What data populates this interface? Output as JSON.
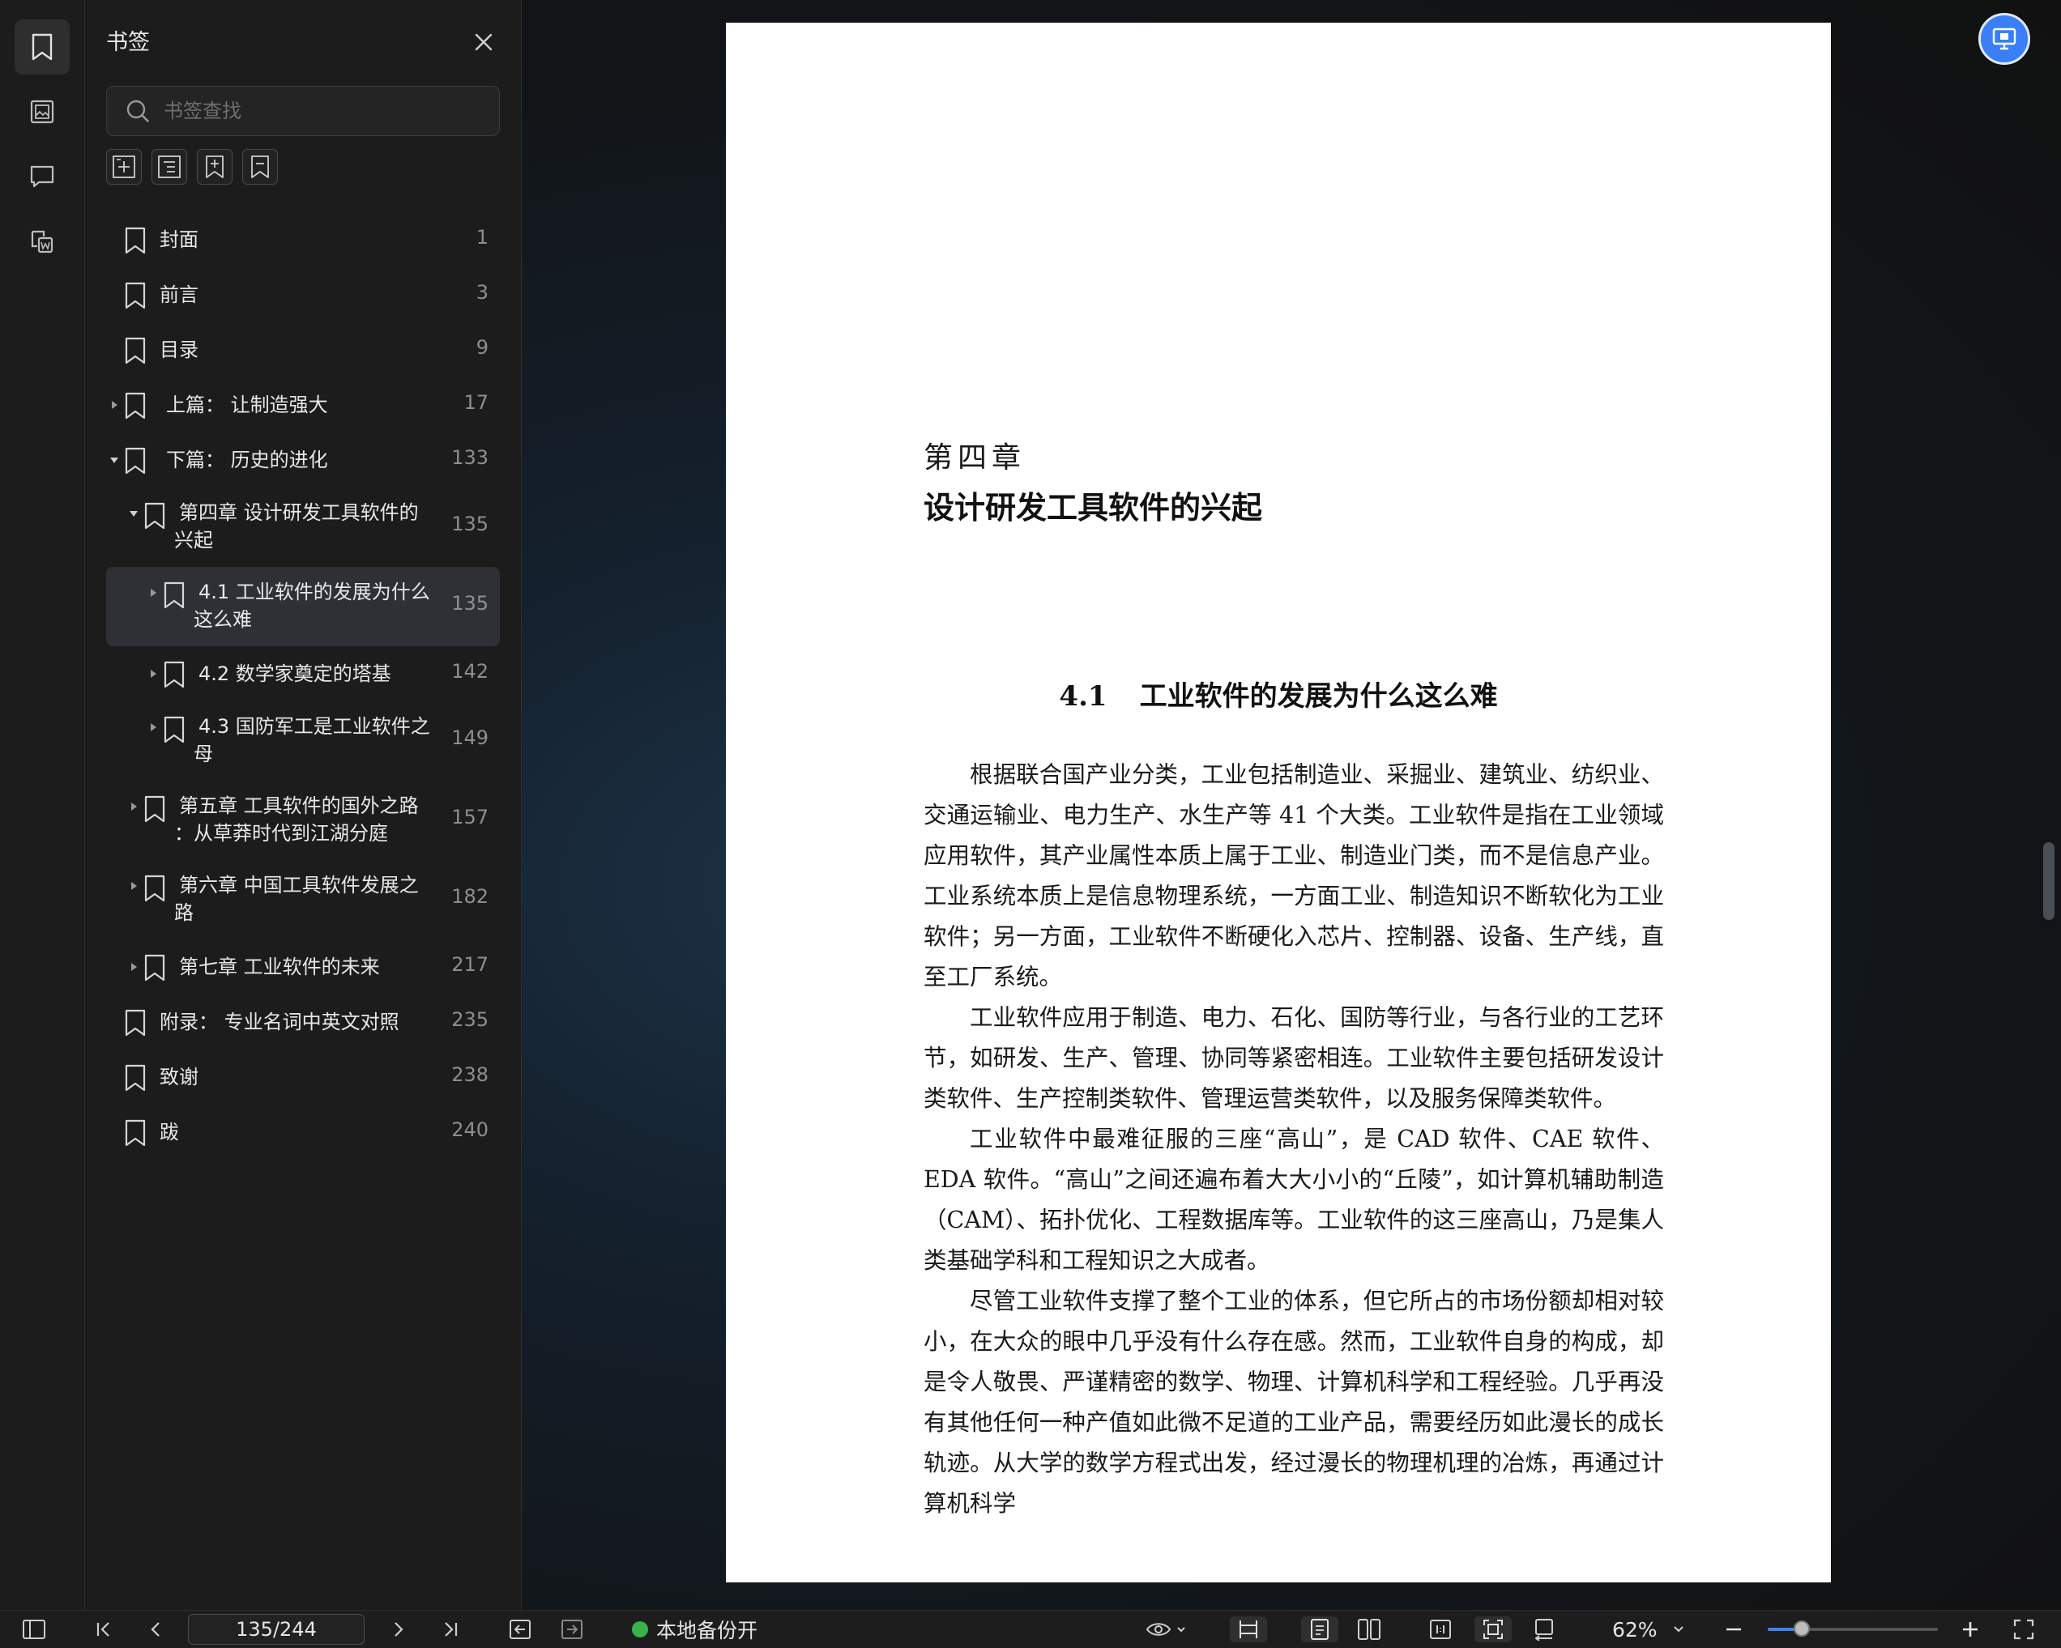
{
  "sidebar": {
    "title": "书签",
    "search_placeholder": "书签查找",
    "bookmarks": [
      {
        "label": "封面",
        "page": "1",
        "level": 0,
        "arrow": "none"
      },
      {
        "label": "前言",
        "page": "3",
        "level": 0,
        "arrow": "none"
      },
      {
        "label": "目录",
        "page": "9",
        "level": 0,
        "arrow": "none"
      },
      {
        "label": "上篇： 让制造强大",
        "page": "17",
        "level": 0,
        "arrow": "right"
      },
      {
        "label": "下篇： 历史的进化",
        "page": "133",
        "level": 0,
        "arrow": "down"
      },
      {
        "label": "第四章 设计研发工具软件的兴起",
        "page": "135",
        "level": 1,
        "arrow": "down",
        "lines": [
          "第四章 设计研发工具软件的",
          "兴起"
        ]
      },
      {
        "label": "4.1 工业软件的发展为什么这么难",
        "page": "135",
        "level": 2,
        "arrow": "right",
        "selected": true,
        "lines": [
          "4.1 工业软件的发展为什么",
          "这么难"
        ]
      },
      {
        "label": "4.2 数学家奠定的塔基",
        "page": "142",
        "level": 2,
        "arrow": "right"
      },
      {
        "label": "4.3 国防军工是工业软件之母",
        "page": "149",
        "level": 2,
        "arrow": "right",
        "lines": [
          "4.3 国防军工是工业软件之",
          "母"
        ]
      },
      {
        "label": "第五章 工具软件的国外之路：从草莽时代到江湖分庭",
        "page": "157",
        "level": 1,
        "arrow": "right",
        "lines": [
          "第五章 工具软件的国外之路",
          "：从草莽时代到江湖分庭"
        ]
      },
      {
        "label": "第六章 中国工具软件发展之路",
        "page": "182",
        "level": 1,
        "arrow": "right",
        "lines": [
          "第六章 中国工具软件发展之",
          "路"
        ]
      },
      {
        "label": "第七章 工业软件的未来",
        "page": "217",
        "level": 1,
        "arrow": "right"
      },
      {
        "label": "附录： 专业名词中英文对照",
        "page": "235",
        "level": 0,
        "arrow": "none"
      },
      {
        "label": "致谢",
        "page": "238",
        "level": 0,
        "arrow": "none"
      },
      {
        "label": "跋",
        "page": "240",
        "level": 0,
        "arrow": "none"
      }
    ]
  },
  "document": {
    "chapter_number": "第四章",
    "chapter_title": "设计研发工具软件的兴起",
    "section_number": "4.1",
    "section_title": "工业软件的发展为什么这么难",
    "paragraphs": [
      "根据联合国产业分类，工业包括制造业、采掘业、建筑业、纺织业、交通运输业、电力生产、水生产等 41 个大类。工业软件是指在工业领域应用软件，其产业属性本质上属于工业、制造业门类，而不是信息产业。工业系统本质上是信息物理系统，一方面工业、制造知识不断软化为工业软件；另一方面，工业软件不断硬化入芯片、控制器、设备、生产线，直至工厂系统。",
      "工业软件应用于制造、电力、石化、国防等行业，与各行业的工艺环节，如研发、生产、管理、协同等紧密相连。工业软件主要包括研发设计类软件、生产控制类软件、管理运营类软件，以及服务保障类软件。",
      "工业软件中最难征服的三座“高山”，是 CAD 软件、CAE 软件、EDA 软件。“高山”之间还遍布着大大小小的“丘陵”，如计算机辅助制造（CAM）、拓扑优化、工程数据库等。工业软件的这三座高山，乃是集人类基础学科和工程知识之大成者。",
      "尽管工业软件支撑了整个工业的体系，但它所占的市场份额却相对较小，在大众的眼中几乎没有什么存在感。然而，工业软件自身的构成，却是令人敬畏、严谨精密的数学、物理、计算机科学和工程经验。几乎再没有其他任何一种产值如此微不足道的工业产品，需要经历如此漫长的成长轨迹。从大学的数学方程式出发，经过漫长的物理机理的冶炼，再通过计算机科学"
    ]
  },
  "statusbar": {
    "page_indicator": "135/244",
    "backup_label": "本地备份开",
    "backup_color": "#38b24a",
    "zoom": "62%",
    "zoom_fraction": 0.2
  },
  "colors": {
    "accent": "#3b82f6",
    "panel": "#1c1c1c",
    "selected_row": "#2e3035"
  }
}
